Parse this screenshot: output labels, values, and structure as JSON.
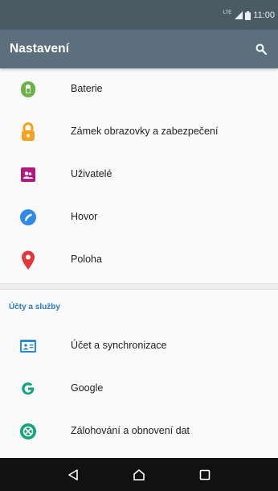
{
  "status_bar": {
    "network": "LTE",
    "time": "11:00"
  },
  "app_bar": {
    "title": "Nastavení",
    "search_icon": "search-icon"
  },
  "colors": {
    "status_bar": "#4a5b64",
    "app_bar": "#5b707c",
    "section_header": "#2c7ab8",
    "battery_icon": "#6ab446",
    "lock_icon": "#f5a21e",
    "users_icon": "#b0197e",
    "call_icon": "#2f89e6",
    "location_icon": "#e3363b",
    "account_icon": "#2a8ad6",
    "google_icon": "#13a37d",
    "backup_icon": "#13a37d"
  },
  "items_top": [
    {
      "label": "Baterie",
      "icon": "battery-icon"
    },
    {
      "label": "Zámek obrazovky a zabezpečení",
      "icon": "lock-icon"
    },
    {
      "label": "Uživatelé",
      "icon": "users-icon"
    },
    {
      "label": "Hovor",
      "icon": "phone-icon"
    },
    {
      "label": "Poloha",
      "icon": "location-pin-icon"
    }
  ],
  "section": {
    "title": "Účty a služby"
  },
  "items_bottom": [
    {
      "label": "Účet a synchronizace",
      "icon": "account-sync-icon"
    },
    {
      "label": "Google",
      "icon": "google-icon"
    },
    {
      "label": "Zálohování a obnovení dat",
      "icon": "backup-icon"
    }
  ],
  "nav_bar": {
    "back": "back-icon",
    "home": "home-icon",
    "recents": "recents-icon"
  }
}
